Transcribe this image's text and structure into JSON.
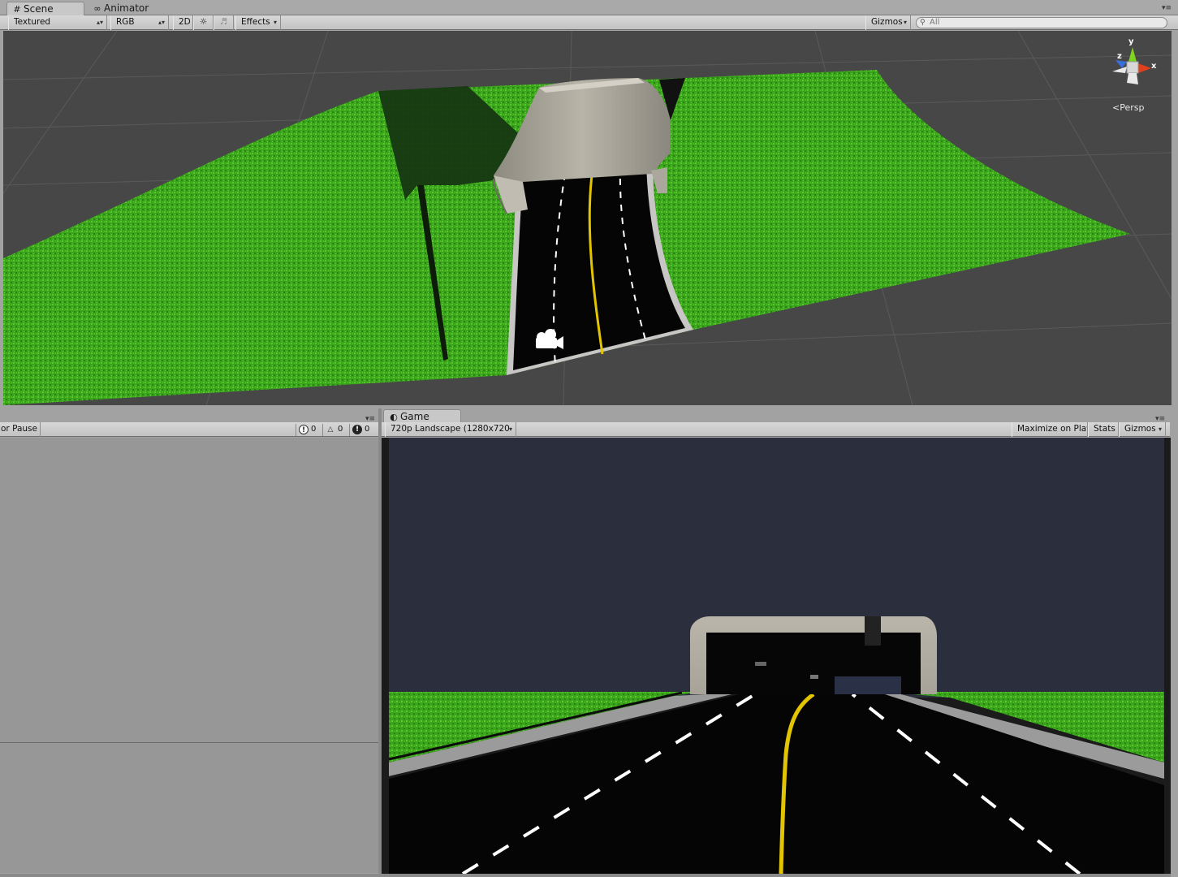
{
  "scene_tabs": {
    "scene": {
      "label": "Scene",
      "icon": "grid-icon"
    },
    "animator": {
      "label": "Animator",
      "icon": "animator-icon"
    }
  },
  "scene_toolbar": {
    "draw_mode": "Textured",
    "render_mode": "RGB",
    "toggle_2d": "2D",
    "effects": "Effects",
    "gizmos": "Gizmos",
    "search_placeholder": "All"
  },
  "scene_gizmo": {
    "axis_y": "y",
    "axis_x": "x",
    "axis_z": "z",
    "projection": "Persp"
  },
  "console": {
    "truncated_label": "or Pause",
    "info_count": "0",
    "warning_count": "0",
    "error_count": "0"
  },
  "game_tab": {
    "label": "Game",
    "icon": "game-icon"
  },
  "game_toolbar": {
    "resolution": "720p Landscape (1280x720",
    "maximize_on_play": "Maximize on Play",
    "stats": "Stats",
    "gizmos": "Gizmos"
  },
  "colors": {
    "scene_bg": "#474747",
    "grass": "#3aa41c",
    "road": "#050505",
    "game_sky": "#2b2e3c",
    "lane_yellow": "#e3c400"
  }
}
